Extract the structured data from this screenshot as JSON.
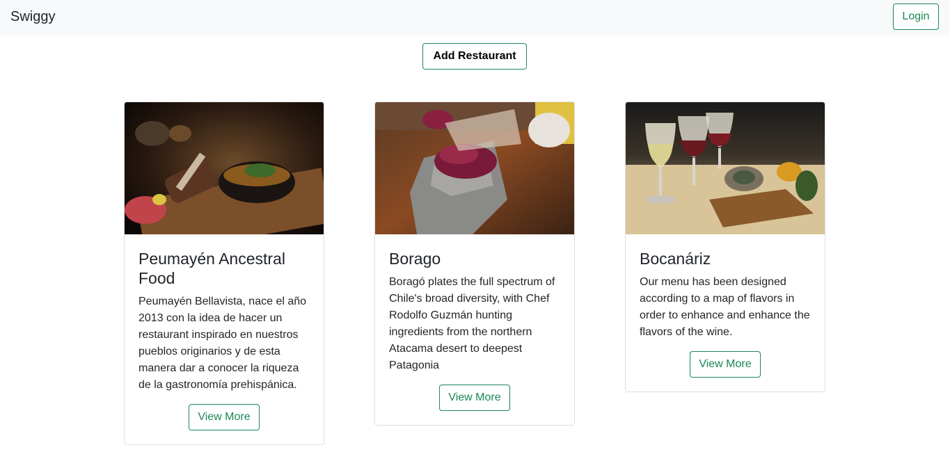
{
  "navbar": {
    "brand": "Swiggy",
    "login_label": "Login"
  },
  "actions": {
    "add_restaurant_label": "Add Restaurant"
  },
  "restaurants": [
    {
      "title": "Peumayén Ancestral Food",
      "description": "Peumayén Bellavista, nace el año 2013 con la idea de hacer un restaurant inspirado en nuestros pueblos originarios y de esta manera dar a conocer la riqueza de la gastronomía prehispánica.",
      "button_label": "View More"
    },
    {
      "title": "Borago",
      "description": "Boragó plates the full spectrum of Chile's broad diversity, with Chef Rodolfo Guzmán hunting ingredients from the northern Atacama desert to deepest Patagonia",
      "button_label": "View More"
    },
    {
      "title": "Bocanáriz",
      "description": "Our menu has been designed according to a map of flavors in order to enhance and enhance the flavors of the wine.",
      "button_label": "View More"
    }
  ],
  "colors": {
    "navbar_bg": "#f8f9fa",
    "accent_green": "#198754",
    "card_border": "#dfdfdf"
  }
}
